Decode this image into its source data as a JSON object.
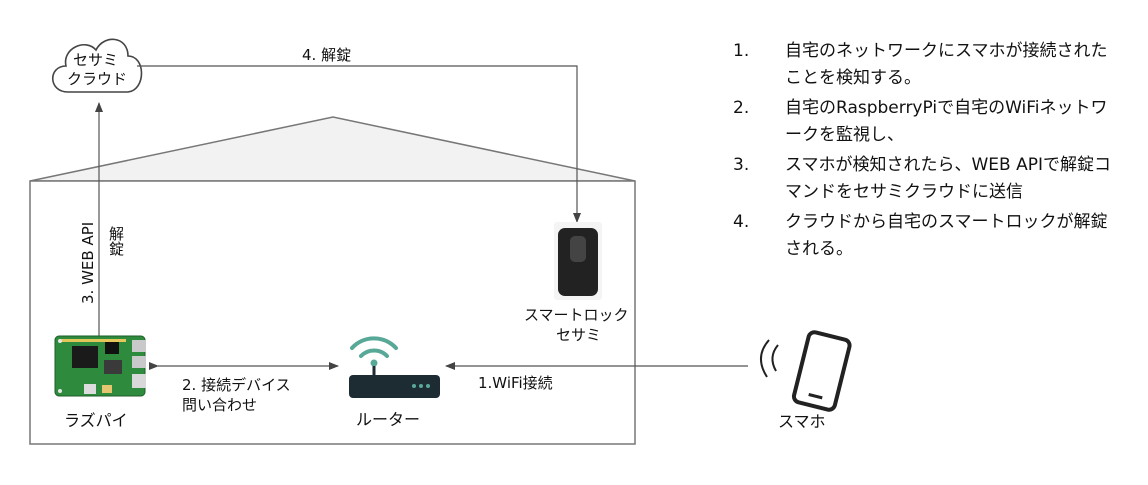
{
  "nodes": {
    "cloud": {
      "line1": "セサミ",
      "line2": "クラウド"
    },
    "raspi": {
      "label": "ラズパイ"
    },
    "router": {
      "label": "ルーター"
    },
    "lock": {
      "line1": "スマートロック",
      "line2": "セサミ"
    },
    "phone": {
      "label": "スマホ"
    }
  },
  "edges": {
    "unlock_cloud_to_lock": "4. 解錠",
    "webapi_line1": "3. WEB API",
    "webapi_line2": "解錠",
    "raspi_router_line1": "2. 接続デバイス",
    "raspi_router_line2": "問い合わせ",
    "phone_router": "1.WiFi接続"
  },
  "steps": [
    {
      "num": "1.",
      "text": "自宅のネットワークにスマホが接続されたことを検知する。"
    },
    {
      "num": "2.",
      "text": "自宅のRaspberryPiで自宅のWiFiネットワークを監視し、"
    },
    {
      "num": "3.",
      "text": "スマホが検知されたら、WEB APIで解錠コマンドをセサミクラウドに送信"
    },
    {
      "num": "4.",
      "text": "クラウドから自宅のスマートロックが解錠される。"
    }
  ],
  "colors": {
    "router_signal": "#58a897",
    "board_green": "#2e8a3c",
    "lock_body": "#222222"
  }
}
